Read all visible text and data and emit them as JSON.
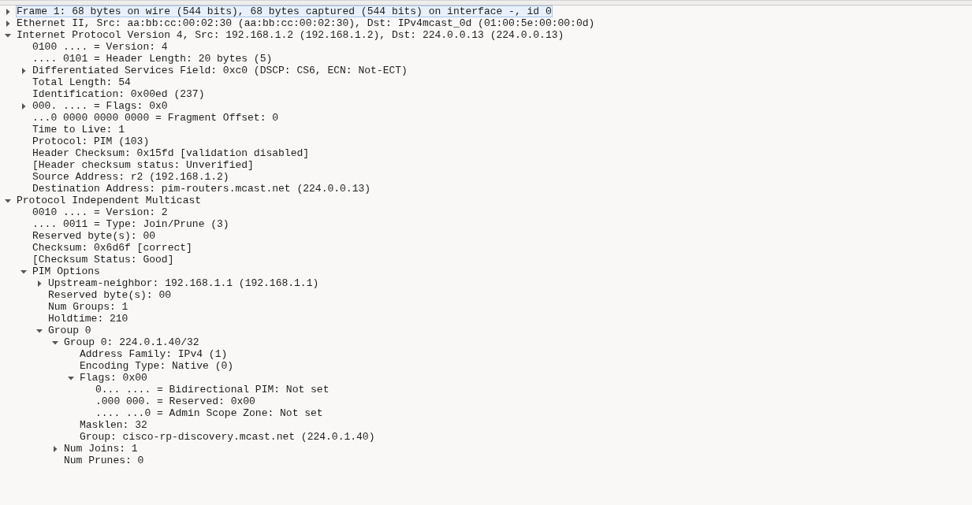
{
  "packet_details": [
    {
      "text": "Frame 1: 68 bytes on wire (544 bits), 68 bytes captured (544 bits) on interface -, id 0",
      "selected": true,
      "expanded": false
    },
    {
      "text": "Ethernet II, Src: aa:bb:cc:00:02:30 (aa:bb:cc:00:02:30), Dst: IPv4mcast_0d (01:00:5e:00:00:0d)",
      "selected": false,
      "expanded": false
    },
    {
      "text": "Internet Protocol Version 4, Src: 192.168.1.2 (192.168.1.2), Dst: 224.0.0.13 (224.0.0.13)",
      "selected": false,
      "expanded": true,
      "children": [
        {
          "text": "0100 .... = Version: 4",
          "selected": false
        },
        {
          "text": ".... 0101 = Header Length: 20 bytes (5)",
          "selected": false
        },
        {
          "text": "Differentiated Services Field: 0xc0 (DSCP: CS6, ECN: Not-ECT)",
          "selected": false,
          "expanded": false
        },
        {
          "text": "Total Length: 54",
          "selected": false
        },
        {
          "text": "Identification: 0x00ed (237)",
          "selected": false
        },
        {
          "text": "000. .... = Flags: 0x0",
          "selected": false,
          "expanded": false
        },
        {
          "text": "...0 0000 0000 0000 = Fragment Offset: 0",
          "selected": false
        },
        {
          "text": "Time to Live: 1",
          "selected": false
        },
        {
          "text": "Protocol: PIM (103)",
          "selected": false
        },
        {
          "text": "Header Checksum: 0x15fd [validation disabled]",
          "selected": false
        },
        {
          "text": "[Header checksum status: Unverified]",
          "selected": false
        },
        {
          "text": "Source Address: r2 (192.168.1.2)",
          "selected": false
        },
        {
          "text": "Destination Address: pim-routers.mcast.net (224.0.0.13)",
          "selected": false
        }
      ]
    },
    {
      "text": "Protocol Independent Multicast",
      "selected": false,
      "expanded": true,
      "children": [
        {
          "text": "0010 .... = Version: 2",
          "selected": false
        },
        {
          "text": ".... 0011 = Type: Join/Prune (3)",
          "selected": false
        },
        {
          "text": "Reserved byte(s): 00",
          "selected": false
        },
        {
          "text": "Checksum: 0x6d6f [correct]",
          "selected": false
        },
        {
          "text": "[Checksum Status: Good]",
          "selected": false
        },
        {
          "text": "PIM Options",
          "selected": false,
          "expanded": true,
          "children": [
            {
              "text": "Upstream-neighbor: 192.168.1.1 (192.168.1.1)",
              "selected": false,
              "expanded": false
            },
            {
              "text": "Reserved byte(s): 00",
              "selected": false
            },
            {
              "text": "Num Groups: 1",
              "selected": false
            },
            {
              "text": "Holdtime: 210",
              "selected": false
            },
            {
              "text": "Group 0",
              "selected": false,
              "expanded": true,
              "children": [
                {
                  "text": "Group 0: 224.0.1.40/32",
                  "selected": false,
                  "expanded": true,
                  "children": [
                    {
                      "text": "Address Family: IPv4 (1)",
                      "selected": false
                    },
                    {
                      "text": "Encoding Type: Native (0)",
                      "selected": false
                    },
                    {
                      "text": "Flags: 0x00",
                      "selected": false,
                      "expanded": true,
                      "children": [
                        {
                          "text": "0... .... = Bidirectional PIM: Not set",
                          "selected": false
                        },
                        {
                          "text": ".000 000. = Reserved: 0x00",
                          "selected": false
                        },
                        {
                          "text": ".... ...0 = Admin Scope Zone: Not set",
                          "selected": false
                        }
                      ]
                    },
                    {
                      "text": "Masklen: 32",
                      "selected": false
                    },
                    {
                      "text": "Group: cisco-rp-discovery.mcast.net (224.0.1.40)",
                      "selected": false
                    }
                  ]
                },
                {
                  "text": "Num Joins: 1",
                  "selected": false,
                  "expanded": false
                },
                {
                  "text": "Num Prunes: 0",
                  "selected": false
                }
              ]
            }
          ]
        }
      ]
    }
  ]
}
